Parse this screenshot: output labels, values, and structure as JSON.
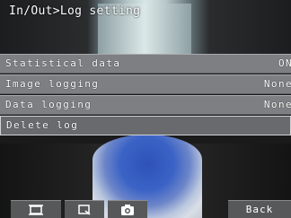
{
  "header": {
    "title": "In/Out>Log setting"
  },
  "menu": {
    "items": [
      {
        "label": "Statistical data",
        "value": "ON"
      },
      {
        "label": "Image logging",
        "value": "None"
      },
      {
        "label": "Data logging",
        "value": "None"
      },
      {
        "label": "Delete log",
        "value": ""
      }
    ]
  },
  "toolbar": {
    "buttons": [
      {
        "icon": "display-frame-icon"
      },
      {
        "icon": "zoom-icon"
      },
      {
        "icon": "camera-icon"
      }
    ],
    "back_label": "Back"
  },
  "colors": {
    "menu_row": "#7d7f82",
    "selected_row": "#686a6d",
    "toolbar": "#575859"
  }
}
